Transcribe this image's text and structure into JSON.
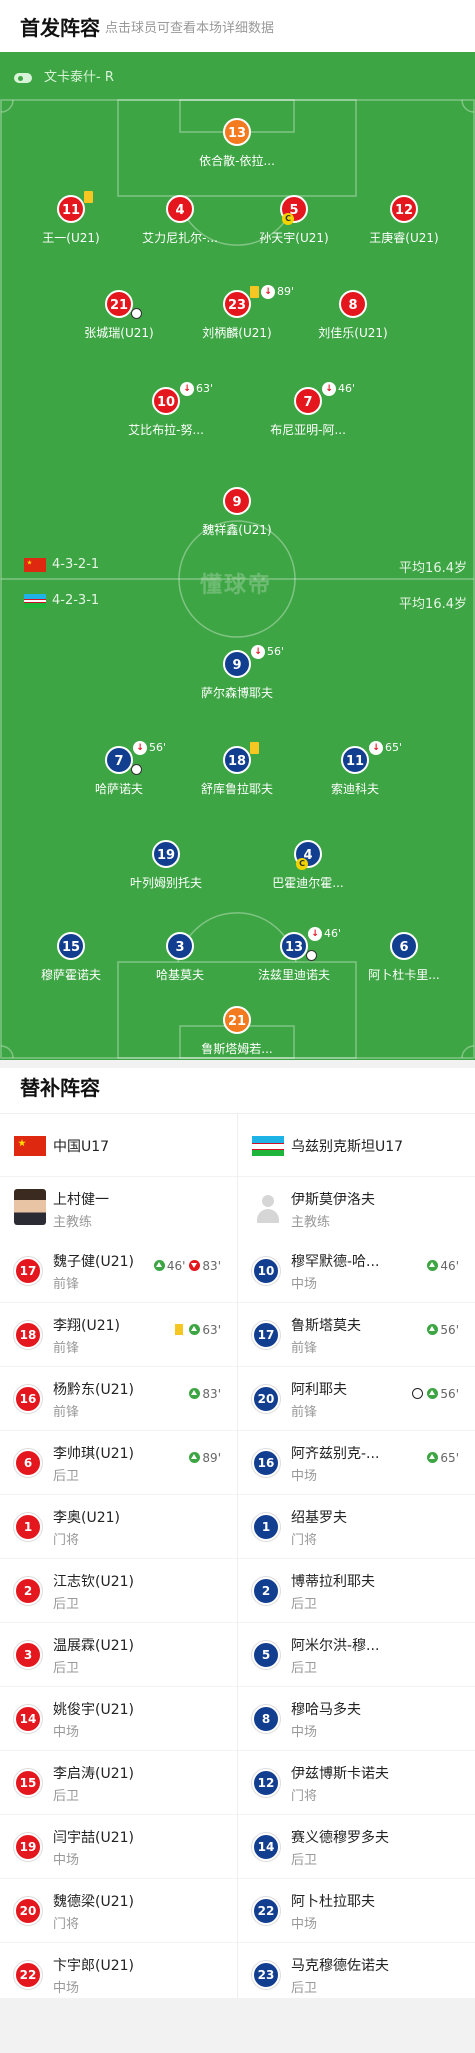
{
  "header": {
    "title": "首发阵容",
    "subtitle": "点击球员可查看本场详细数据"
  },
  "referee": "文卡泰什- R",
  "watermark": "懂球帝",
  "home_form": {
    "formation": "4-3-2-1",
    "avg_age": "平均16.4岁"
  },
  "away_form": {
    "formation": "4-2-3-1",
    "avg_age": "平均16.4岁"
  },
  "home_players": [
    {
      "num": "13",
      "name": "依合散-依拉...",
      "color": "gk"
    },
    {
      "num": "11",
      "name": "王一(U21)",
      "color": "red",
      "card": true
    },
    {
      "num": "4",
      "name": "艾力尼扎尔-...",
      "color": "red"
    },
    {
      "num": "5",
      "name": "孙天宇(U21)",
      "color": "red",
      "captain": true
    },
    {
      "num": "12",
      "name": "王庚睿(U21)",
      "color": "red"
    },
    {
      "num": "21",
      "name": "张城瑞(U21)",
      "color": "red",
      "goal": true
    },
    {
      "num": "23",
      "name": "刘柄麟(U21)",
      "color": "red",
      "card": true,
      "sub_min": "89'"
    },
    {
      "num": "8",
      "name": "刘佳乐(U21)",
      "color": "red"
    },
    {
      "num": "10",
      "name": "艾比布拉-努...",
      "color": "red",
      "sub_min": "63'"
    },
    {
      "num": "7",
      "name": "布尼亚明-阿...",
      "color": "red",
      "sub_min": "46'"
    },
    {
      "num": "9",
      "name": "魏祥鑫(U21)",
      "color": "red"
    }
  ],
  "away_players": [
    {
      "num": "9",
      "name": "萨尔森博耶夫",
      "color": "blue",
      "sub_min": "56'"
    },
    {
      "num": "7",
      "name": "哈萨诺夫",
      "color": "blue",
      "goal": true,
      "sub_min": "56'"
    },
    {
      "num": "18",
      "name": "舒库鲁拉耶夫",
      "color": "blue",
      "card": true
    },
    {
      "num": "11",
      "name": "索迪科夫",
      "color": "blue",
      "sub_min": "65'"
    },
    {
      "num": "19",
      "name": "叶列姆别托夫",
      "color": "blue"
    },
    {
      "num": "4",
      "name": "巴霍迪尔霍...",
      "color": "blue",
      "captain": true
    },
    {
      "num": "15",
      "name": "穆萨霍诺夫",
      "color": "blue"
    },
    {
      "num": "3",
      "name": "哈基莫夫",
      "color": "blue"
    },
    {
      "num": "13",
      "name": "法兹里迪诺夫",
      "color": "blue",
      "goal": true,
      "sub_min": "46'"
    },
    {
      "num": "6",
      "name": "阿卜杜卡里...",
      "color": "blue"
    },
    {
      "num": "21",
      "name": "鲁斯塔姆若...",
      "color": "gk"
    }
  ],
  "subs": {
    "title": "替补阵容",
    "home": {
      "team": "中国U17",
      "coach": {
        "name": "上村健一",
        "role": "主教练"
      },
      "players": [
        {
          "num": "17",
          "name": "魏子健(U21)",
          "pos": "前锋",
          "events": [
            {
              "type": "in",
              "min": "46'"
            },
            {
              "type": "out",
              "min": "83'"
            }
          ]
        },
        {
          "num": "18",
          "name": "李翔(U21)",
          "pos": "前锋",
          "events": [
            {
              "type": "card",
              "min": ""
            },
            {
              "type": "in",
              "min": "63'"
            }
          ]
        },
        {
          "num": "16",
          "name": "杨黔东(U21)",
          "pos": "前锋",
          "events": [
            {
              "type": "in",
              "min": "83'"
            }
          ]
        },
        {
          "num": "6",
          "name": "李帅琪(U21)",
          "pos": "后卫",
          "events": [
            {
              "type": "in",
              "min": "89'"
            }
          ]
        },
        {
          "num": "1",
          "name": "李奥(U21)",
          "pos": "门将",
          "events": []
        },
        {
          "num": "2",
          "name": "江志钦(U21)",
          "pos": "后卫",
          "events": []
        },
        {
          "num": "3",
          "name": "温展霖(U21)",
          "pos": "后卫",
          "events": []
        },
        {
          "num": "14",
          "name": "姚俊宇(U21)",
          "pos": "中场",
          "events": []
        },
        {
          "num": "15",
          "name": "李启涛(U21)",
          "pos": "后卫",
          "events": []
        },
        {
          "num": "19",
          "name": "闫宇喆(U21)",
          "pos": "中场",
          "events": []
        },
        {
          "num": "20",
          "name": "魏德梁(U21)",
          "pos": "门将",
          "events": []
        },
        {
          "num": "22",
          "name": "卞宇郎(U21)",
          "pos": "中场",
          "events": []
        }
      ]
    },
    "away": {
      "team": "乌兹别克斯坦U17",
      "coach": {
        "name": "伊斯莫伊洛夫",
        "role": "主教练"
      },
      "players": [
        {
          "num": "10",
          "name": "穆罕默德-哈...",
          "pos": "中场",
          "events": [
            {
              "type": "in",
              "min": "46'"
            }
          ]
        },
        {
          "num": "17",
          "name": "鲁斯塔莫夫",
          "pos": "前锋",
          "events": [
            {
              "type": "in",
              "min": "56'"
            }
          ]
        },
        {
          "num": "20",
          "name": "阿利耶夫",
          "pos": "前锋",
          "events": [
            {
              "type": "ball",
              "min": ""
            },
            {
              "type": "in",
              "min": "56'"
            }
          ]
        },
        {
          "num": "16",
          "name": "阿齐兹别克-...",
          "pos": "中场",
          "events": [
            {
              "type": "in",
              "min": "65'"
            }
          ]
        },
        {
          "num": "1",
          "name": "绍基罗夫",
          "pos": "门将",
          "events": []
        },
        {
          "num": "2",
          "name": "博蒂拉利耶夫",
          "pos": "后卫",
          "events": []
        },
        {
          "num": "5",
          "name": "阿米尔洪-穆...",
          "pos": "后卫",
          "events": []
        },
        {
          "num": "8",
          "name": "穆哈马多夫",
          "pos": "中场",
          "events": []
        },
        {
          "num": "12",
          "name": "伊兹博斯卡诺夫",
          "pos": "门将",
          "events": []
        },
        {
          "num": "14",
          "name": "赛义德穆罗多夫",
          "pos": "后卫",
          "events": []
        },
        {
          "num": "22",
          "name": "阿卜杜拉耶夫",
          "pos": "中场",
          "events": []
        },
        {
          "num": "23",
          "name": "马克穆德佐诺夫",
          "pos": "后卫",
          "events": []
        }
      ]
    }
  }
}
